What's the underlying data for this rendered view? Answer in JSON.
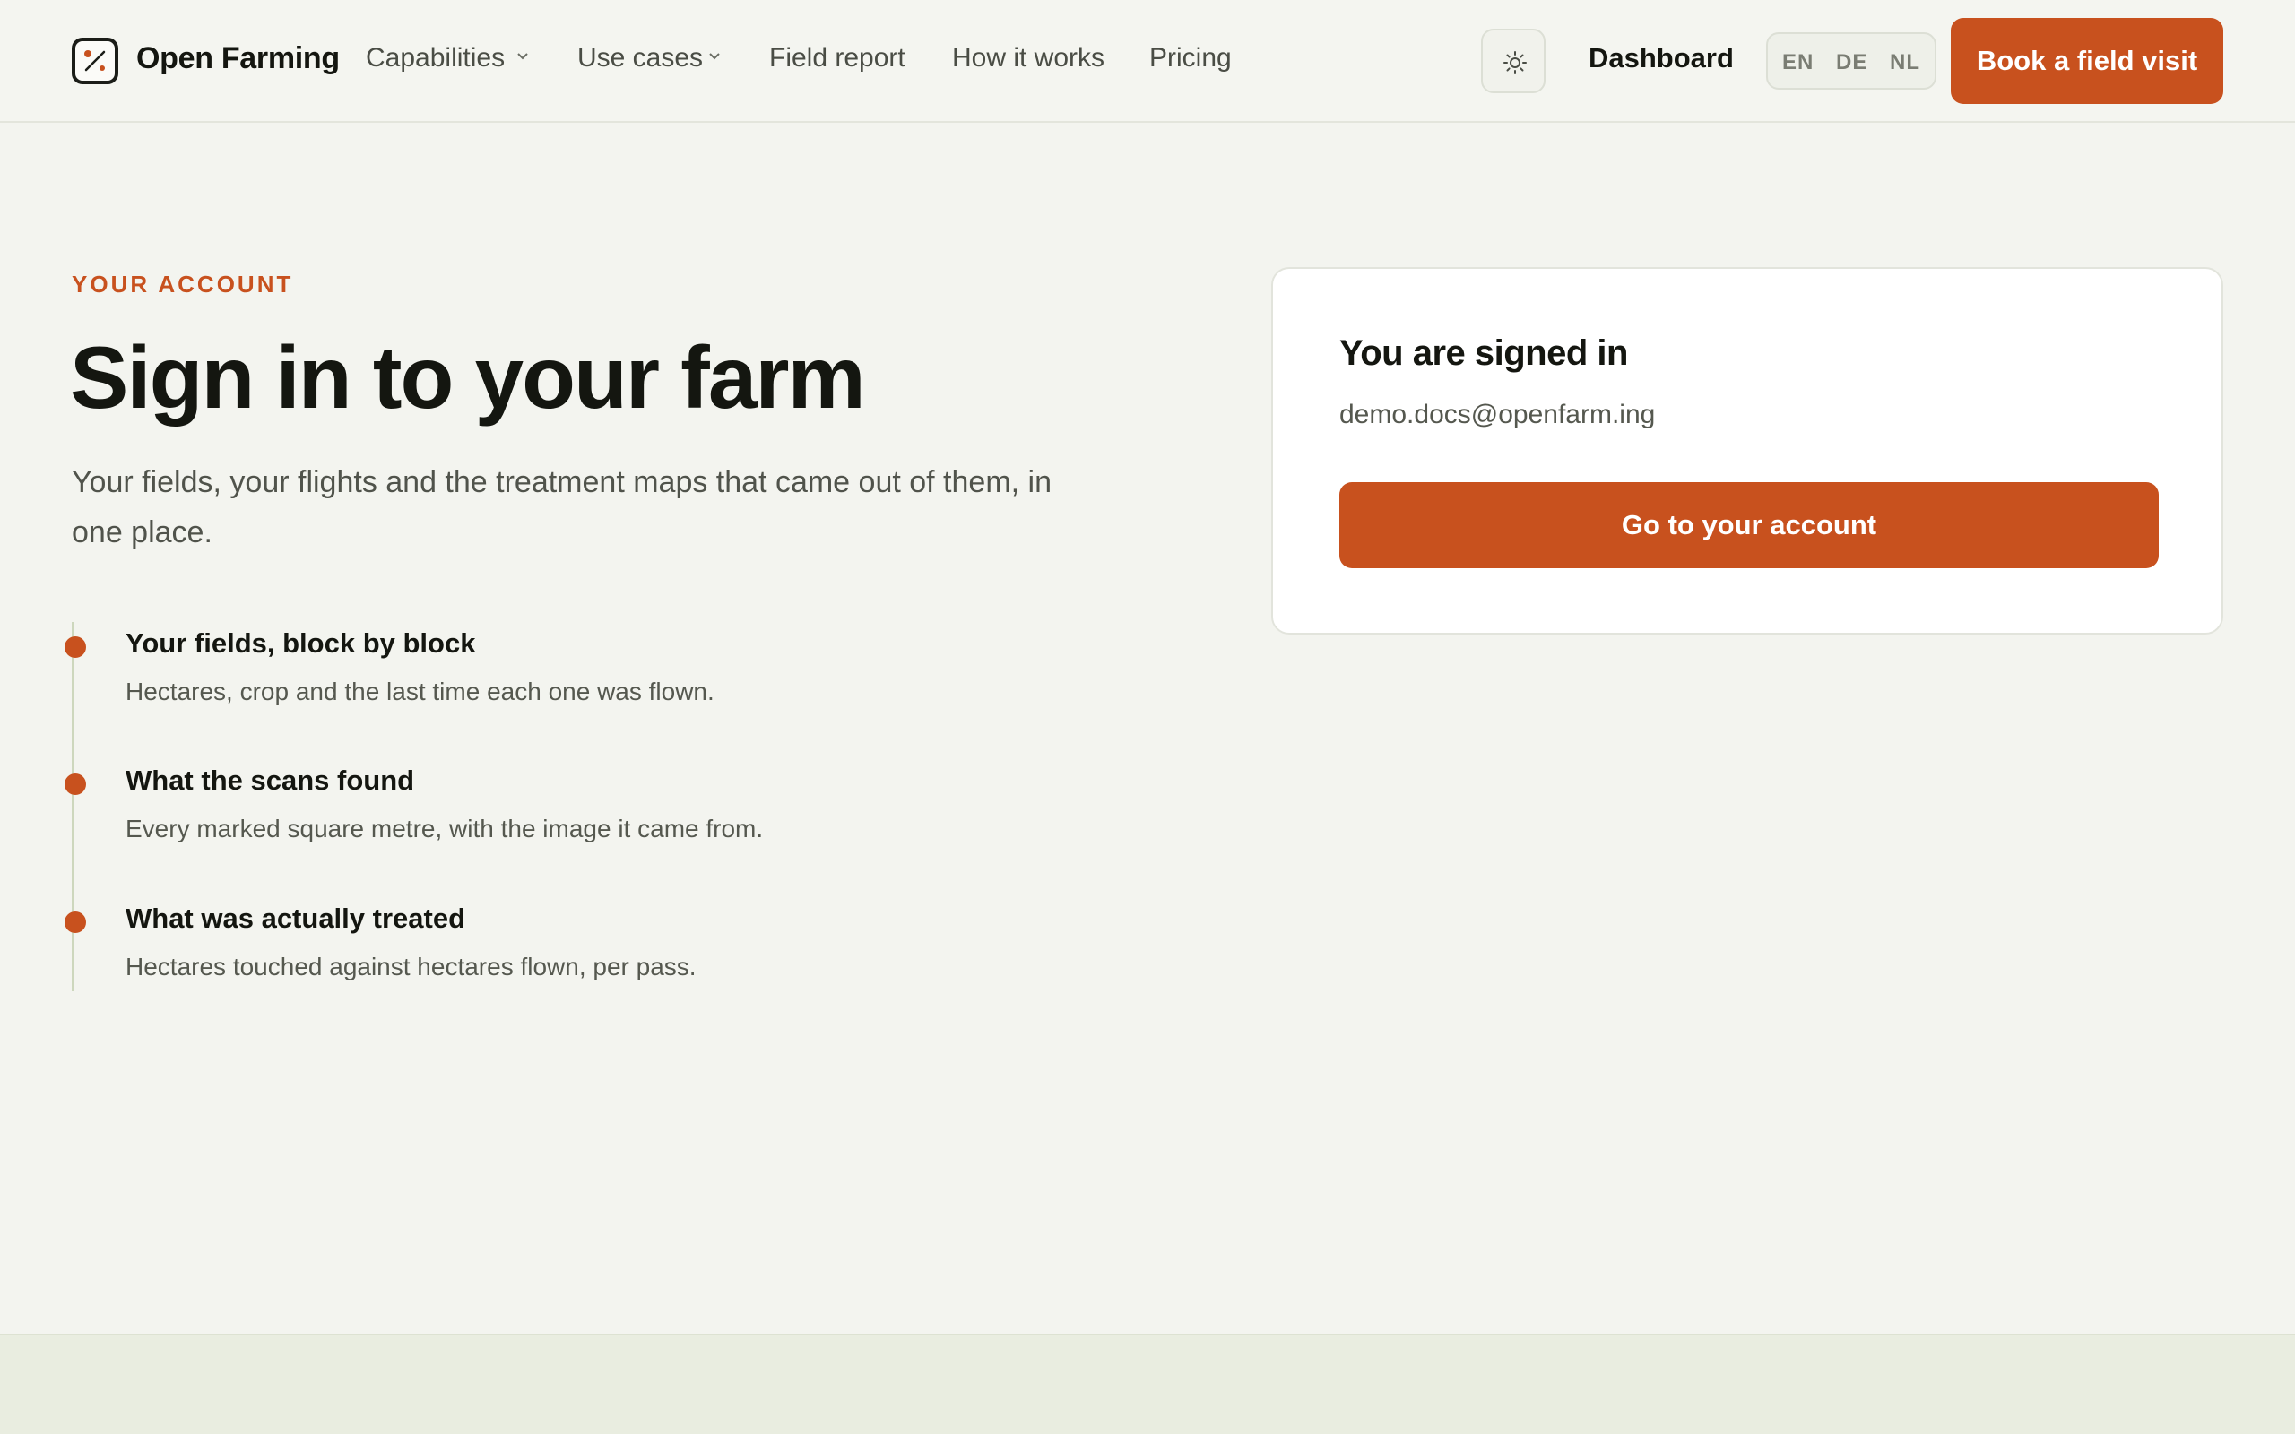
{
  "header": {
    "brand": "Open Farming",
    "nav": [
      {
        "label": "Capabilities"
      },
      {
        "label": "Use cases"
      },
      {
        "label": "Field report"
      },
      {
        "label": "How it works"
      },
      {
        "label": "Pricing"
      }
    ],
    "dashboard_label": "Dashboard",
    "languages": [
      "EN",
      "DE",
      "NL"
    ],
    "cta_label": "Book a field visit"
  },
  "hero": {
    "eyebrow": "YOUR ACCOUNT",
    "title": "Sign in to your farm",
    "subtitle": "Your fields, your flights and the treatment maps that came out of them, in one place."
  },
  "features": [
    {
      "title": "Your fields, block by block",
      "description": "Hectares, crop and the last time each one was flown."
    },
    {
      "title": "What the scans found",
      "description": "Every marked square metre, with the image it came from."
    },
    {
      "title": "What was actually treated",
      "description": "Hectares touched against hectares flown, per pass."
    }
  ],
  "signin_card": {
    "title": "You are signed in",
    "email": "demo.docs@openfarm.ing",
    "button_label": "Go to your account"
  },
  "colors": {
    "accent": "#c8511e",
    "background": "#f3f4ef",
    "text": "#141610",
    "timeline": "#cdd7bd"
  },
  "icons": {
    "logo": "open-farming-logo-icon",
    "theme": "sun-icon",
    "dropdown": "chevron-down-icon",
    "bullet": "bullet-dot-icon"
  }
}
